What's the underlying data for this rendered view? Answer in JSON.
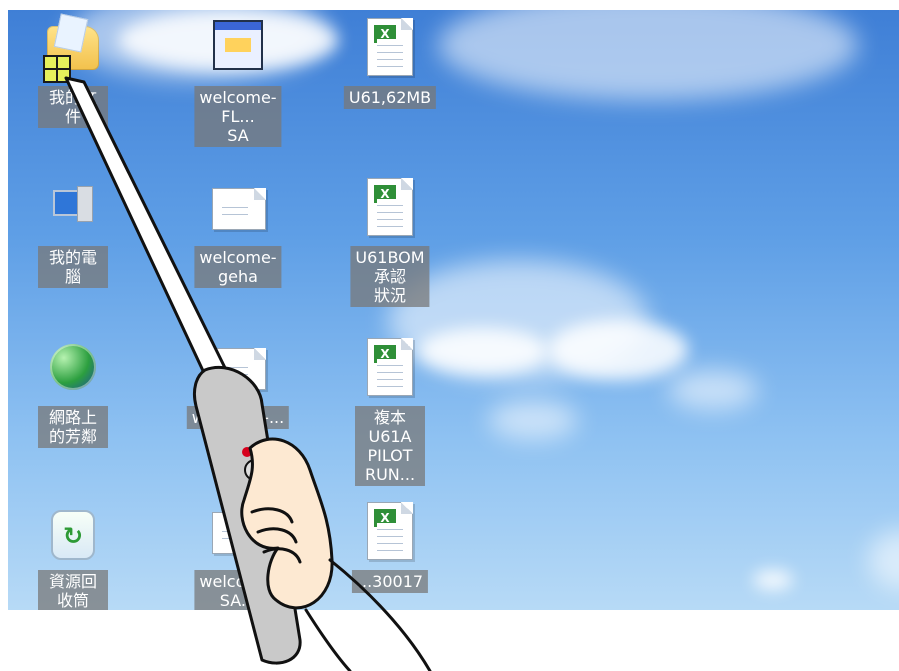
{
  "desktop": {
    "icons": [
      {
        "id": "my-documents",
        "label": "我的文件",
        "type": "folder"
      },
      {
        "id": "welcome-flsa",
        "label": "welcome-FL...\nSA",
        "type": "window"
      },
      {
        "id": "u61-62mb",
        "label": "U61,62MB",
        "type": "excel"
      },
      {
        "id": "my-computer",
        "label": "我的電腦",
        "type": "pc"
      },
      {
        "id": "welcome-geha",
        "label": "welcome-geha",
        "type": "doc"
      },
      {
        "id": "u61bom",
        "label": "U61BOM 承認\n狀況",
        "type": "excel"
      },
      {
        "id": "network-places",
        "label": "網路上的芳鄰",
        "type": "globe"
      },
      {
        "id": "welcome-3",
        "label": "welcome-...",
        "type": "doc"
      },
      {
        "id": "copy-u61a",
        "label": "複本 U61A\nPILOT RUN...",
        "type": "excel"
      },
      {
        "id": "recycle-bin",
        "label": "資源回收筒",
        "type": "bin"
      },
      {
        "id": "welcome-sa",
        "label": "welcome-SA...",
        "type": "doc"
      },
      {
        "id": "excel-30017",
        "label": "...30017",
        "type": "excel"
      }
    ]
  },
  "colors": {
    "sky_top": "#3f7fd6",
    "sky_bottom": "#b7daf6",
    "pointer_outline": "#111111",
    "pointer_fill": "#ffffff",
    "handle_fill": "#c9c9c9",
    "hand_fill": "#fde9d2",
    "dot_red": "#d6001c"
  }
}
